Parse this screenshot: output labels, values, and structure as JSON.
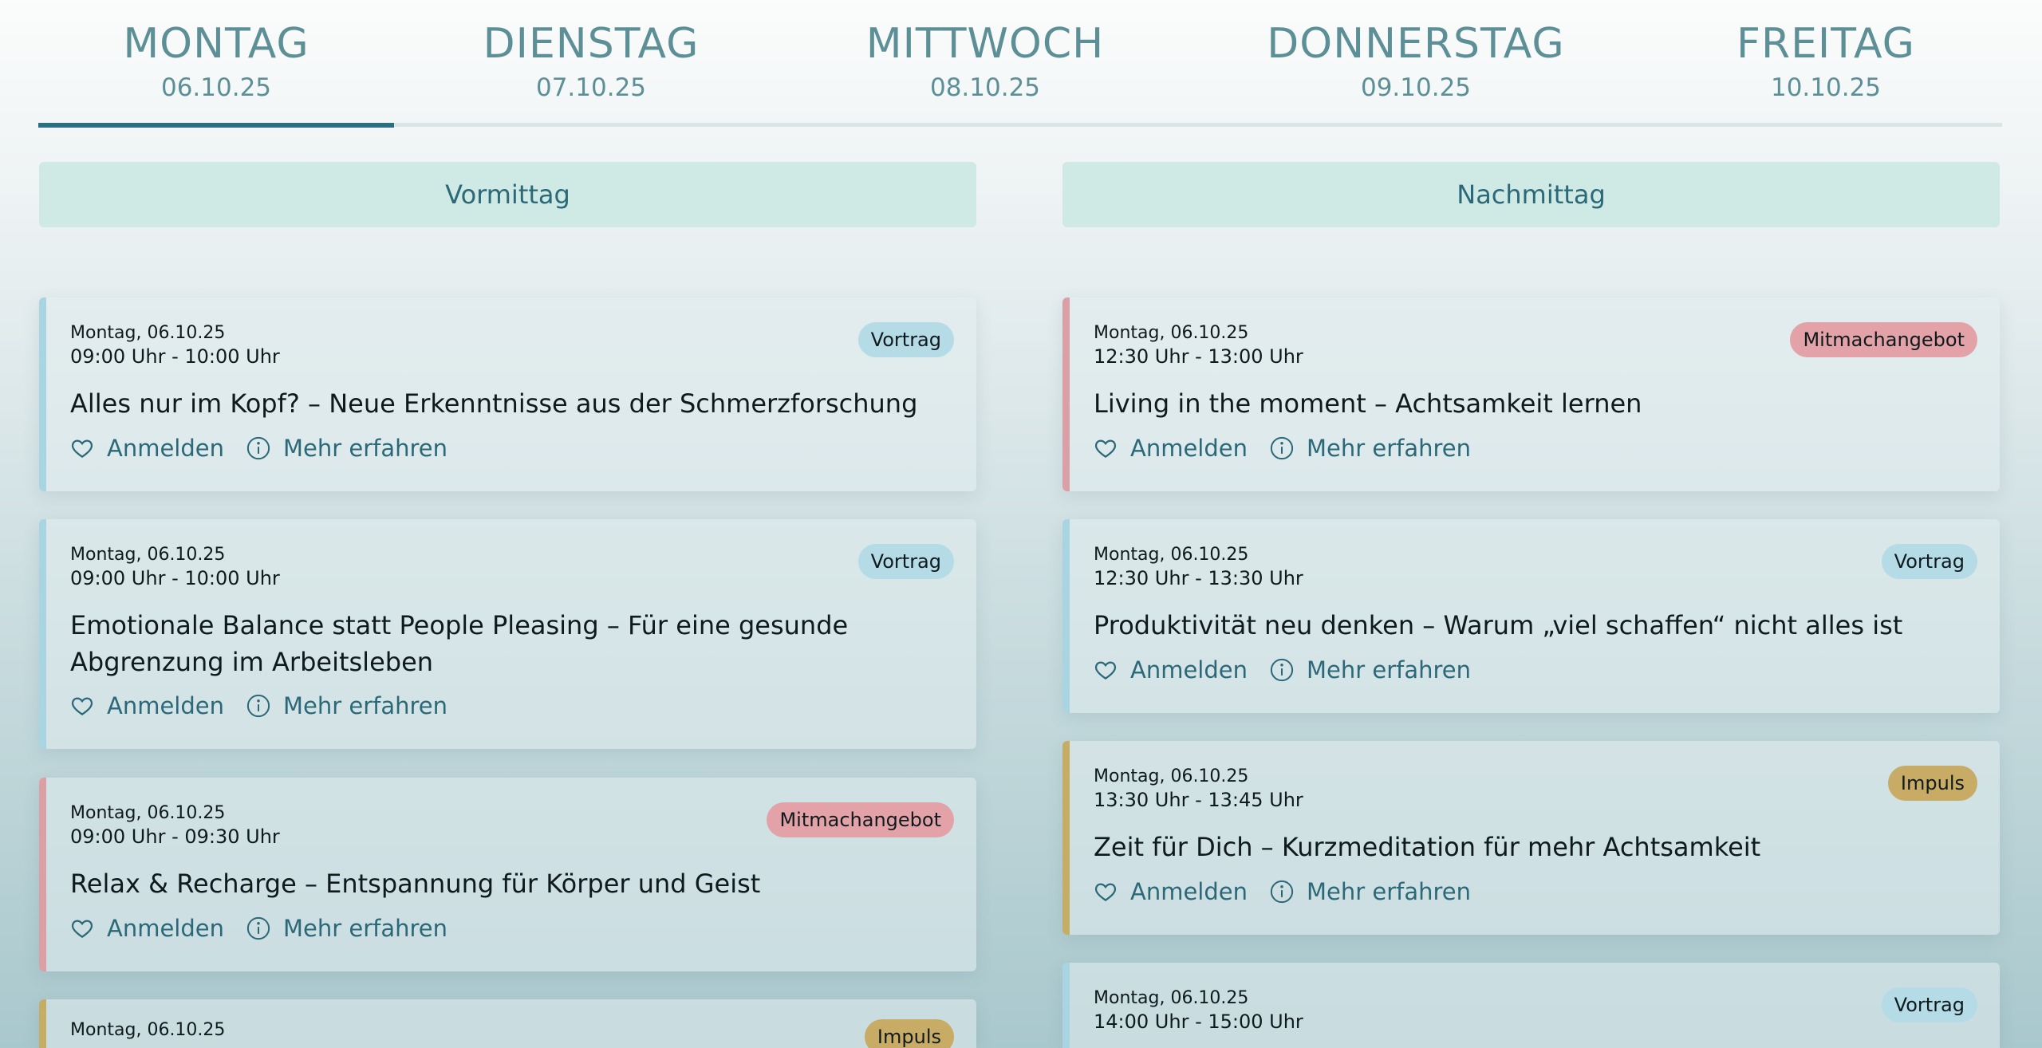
{
  "tabs": [
    {
      "name": "MONTAG",
      "date": "06.10.25"
    },
    {
      "name": "DIENSTAG",
      "date": "07.10.25"
    },
    {
      "name": "MITTWOCH",
      "date": "08.10.25"
    },
    {
      "name": "DONNERSTAG",
      "date": "09.10.25"
    },
    {
      "name": "FREITAG",
      "date": "10.10.25"
    }
  ],
  "periods": {
    "morning": "Vormittag",
    "afternoon": "Nachmittag"
  },
  "actions": {
    "register": "Anmelden",
    "more": "Mehr erfahren"
  },
  "morning": [
    {
      "date": "Montag, 06.10.25",
      "time": "09:00 Uhr - 10:00 Uhr",
      "type": "Vortrag",
      "title": "Alles nur im Kopf? – Neue Erkenntnisse aus der Schmerzforschung"
    },
    {
      "date": "Montag, 06.10.25",
      "time": "09:00 Uhr - 10:00 Uhr",
      "type": "Vortrag",
      "title": "Emotionale Balance statt People Pleasing – Für eine gesunde Abgrenzung im Arbeitsleben"
    },
    {
      "date": "Montag, 06.10.25",
      "time": "09:00 Uhr - 09:30 Uhr",
      "type": "Mitmachangebot",
      "title": "Relax & Recharge – Entspannung für Körper und Geist"
    },
    {
      "date": "Montag, 06.10.25",
      "type": "Impuls"
    }
  ],
  "afternoon": [
    {
      "date": "Montag, 06.10.25",
      "time": "12:30 Uhr - 13:00 Uhr",
      "type": "Mitmachangebot",
      "title": "Living in the moment – Achtsamkeit lernen"
    },
    {
      "date": "Montag, 06.10.25",
      "time": "12:30 Uhr - 13:30 Uhr",
      "type": "Vortrag",
      "title": "Produktivität neu denken – Warum „viel schaffen“ nicht alles ist"
    },
    {
      "date": "Montag, 06.10.25",
      "time": "13:30 Uhr - 13:45 Uhr",
      "type": "Impuls",
      "title": "Zeit für Dich – Kurzmeditation für mehr Achtsamkeit"
    },
    {
      "date": "Montag, 06.10.25",
      "time": "14:00 Uhr - 15:00 Uhr",
      "type": "Vortrag"
    }
  ]
}
